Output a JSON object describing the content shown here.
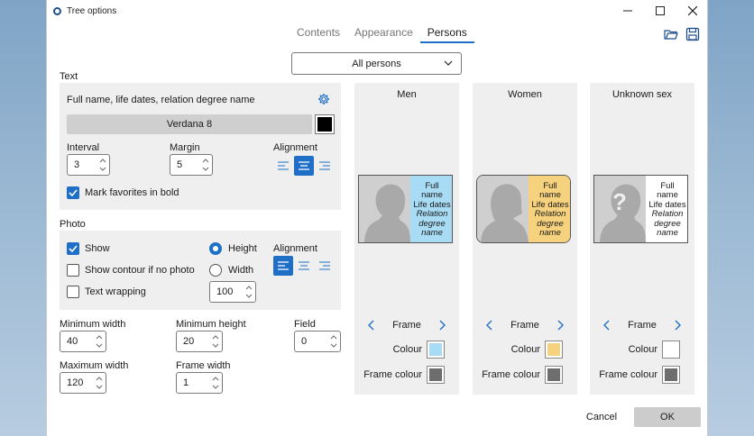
{
  "window": {
    "title": "Tree options"
  },
  "tabs": [
    {
      "label": "Contents",
      "active": false
    },
    {
      "label": "Appearance",
      "active": false
    },
    {
      "label": "Persons",
      "active": true
    }
  ],
  "person_select": {
    "value": "All persons"
  },
  "text_section": {
    "label": "Text",
    "content_label": "Full name, life dates, relation degree name",
    "font": "Verdana 8",
    "font_color": "#000000",
    "interval_label": "Interval",
    "interval_value": "3",
    "margin_label": "Margin",
    "margin_value": "5",
    "alignment_label": "Alignment",
    "alignment": "center",
    "favorites_label": "Mark favorites in bold",
    "favorites_checked": true
  },
  "photo_section": {
    "label": "Photo",
    "show_label": "Show",
    "show_checked": true,
    "contour_label": "Show contour if no photo",
    "contour_checked": false,
    "wrapping_label": "Text wrapping",
    "wrapping_checked": false,
    "height_label": "Height",
    "width_label": "Width",
    "size_mode": "height",
    "size_value": "100",
    "alignment_label": "Alignment",
    "alignment": "left"
  },
  "sizes": {
    "min_width_label": "Minimum width",
    "min_width_value": "40",
    "min_height_label": "Minimum height",
    "min_height_value": "20",
    "field_label": "Field",
    "field_value": "0",
    "max_width_label": "Maximum width",
    "max_width_value": "120",
    "frame_width_label": "Frame width",
    "frame_width_value": "1"
  },
  "columns": [
    {
      "title": "Men",
      "card_bg": "#a8dcf5",
      "card_lines": [
        "Full",
        "name",
        "Life dates"
      ],
      "card_italic": [
        "Relation",
        "degree",
        "name"
      ],
      "frame_label": "Frame",
      "colour_label": "Colour",
      "colour": "#a8dcf5",
      "frame_colour_label": "Frame colour",
      "frame_colour": "#6e6e6e",
      "sil": "male",
      "rounded": false
    },
    {
      "title": "Women",
      "card_bg": "#f7d27e",
      "card_lines": [
        "Full",
        "name",
        "Life dates"
      ],
      "card_italic": [
        "Relation",
        "degree",
        "name"
      ],
      "frame_label": "Frame",
      "colour_label": "Colour",
      "colour": "#f7d27e",
      "frame_colour_label": "Frame colour",
      "frame_colour": "#6e6e6e",
      "sil": "female",
      "rounded": true
    },
    {
      "title": "Unknown sex",
      "card_bg": "#ffffff",
      "card_lines": [
        "Full",
        "name",
        "Life dates"
      ],
      "card_italic": [
        "Relation",
        "degree",
        "name"
      ],
      "frame_label": "Frame",
      "colour_label": "Colour",
      "colour": "#ffffff",
      "frame_colour_label": "Frame colour",
      "frame_colour": "#6e6e6e",
      "sil": "unknown",
      "rounded": false
    }
  ],
  "footer": {
    "cancel_label": "Cancel",
    "ok_label": "OK"
  },
  "colors": {
    "accent": "#1f6fc7",
    "panel": "#efefef"
  }
}
